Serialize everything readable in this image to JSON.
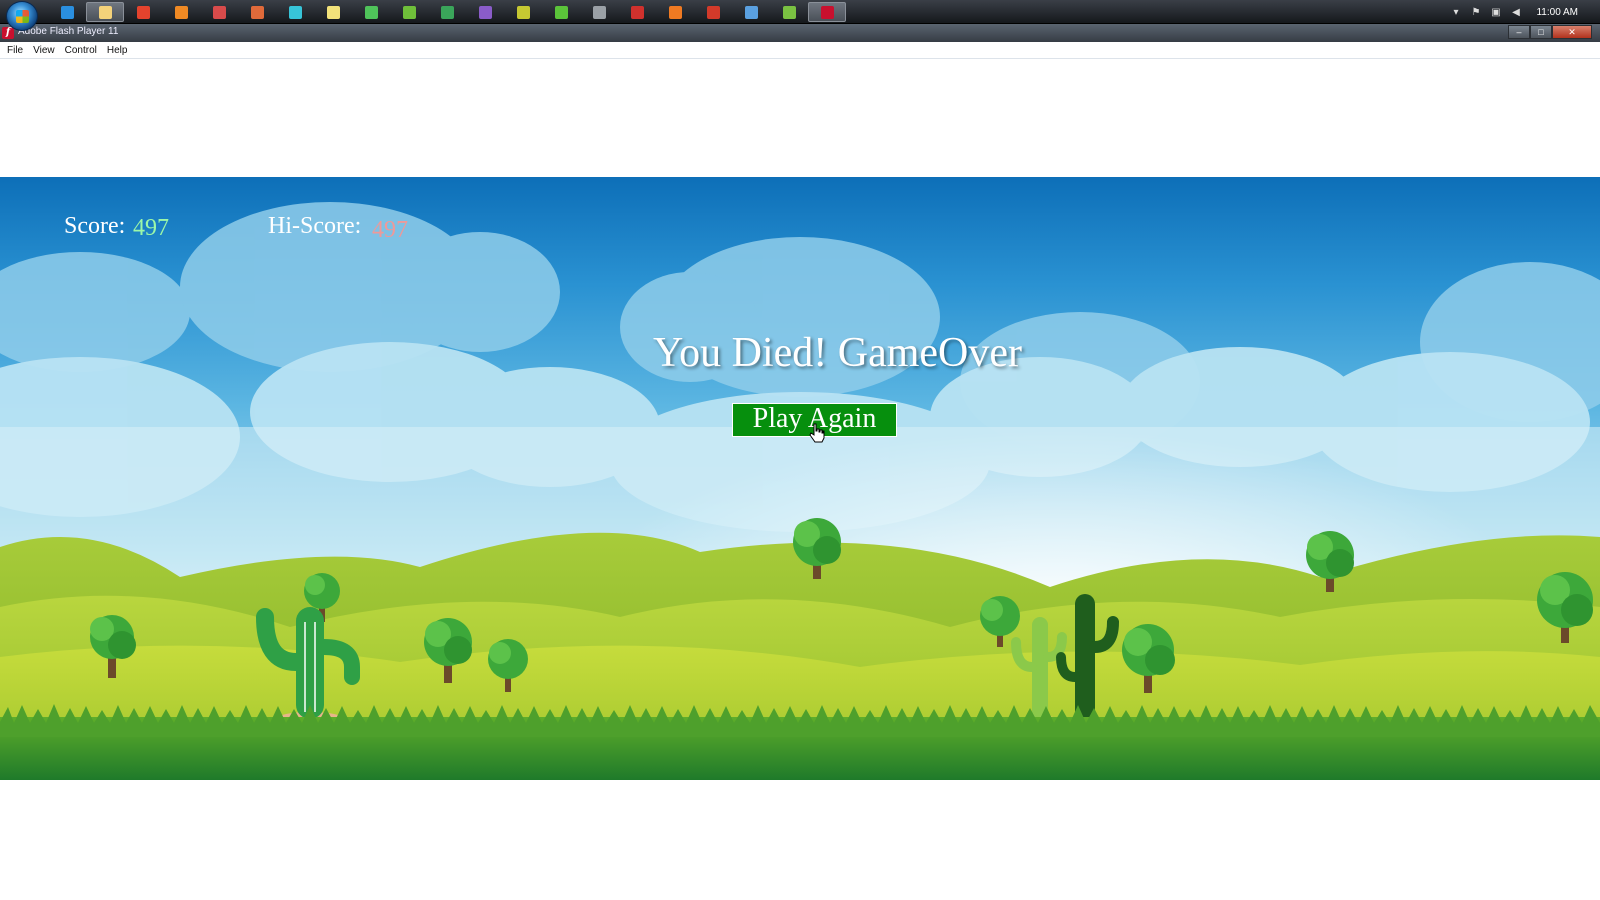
{
  "taskbar": {
    "apps": [
      {
        "name": "internet-explorer-icon",
        "color": "#2a8fe0"
      },
      {
        "name": "file-explorer-icon",
        "color": "#f4d27a",
        "active": true
      },
      {
        "name": "chrome-icon",
        "color": "#e4432d"
      },
      {
        "name": "xampp-icon",
        "color": "#f08a24"
      },
      {
        "name": "paint-icon",
        "color": "#d84b4b"
      },
      {
        "name": "media-icon",
        "color": "#e06a3a"
      },
      {
        "name": "image-editor-icon",
        "color": "#37c4d8"
      },
      {
        "name": "notepad-icon",
        "color": "#f2e27a"
      },
      {
        "name": "spreadsheet-icon",
        "color": "#4fc35a"
      },
      {
        "name": "graph-icon",
        "color": "#6fbf3a"
      },
      {
        "name": "globe-icon",
        "color": "#3aa55a"
      },
      {
        "name": "visual-studio-icon",
        "color": "#8a5cc9"
      },
      {
        "name": "fireworks-icon",
        "color": "#c6c832"
      },
      {
        "name": "dreamweaver-icon",
        "color": "#5bc43a"
      },
      {
        "name": "sound-icon",
        "color": "#9aa0a6"
      },
      {
        "name": "flash-pro-icon",
        "color": "#d0312d"
      },
      {
        "name": "firefox-icon",
        "color": "#f07a22"
      },
      {
        "name": "acrobat-icon",
        "color": "#d23a2a"
      },
      {
        "name": "keyboard-icon",
        "color": "#5aa0e0"
      },
      {
        "name": "utorrent-icon",
        "color": "#7ac142"
      },
      {
        "name": "flash-player-icon",
        "color": "#c8102e",
        "active": true
      }
    ],
    "clock": "11:00 AM"
  },
  "window": {
    "title": "Adobe Flash Player 11",
    "logo_letter": "f",
    "minimize": "–",
    "maximize": "□",
    "close": "✕"
  },
  "menu": [
    "File",
    "View",
    "Control",
    "Help"
  ],
  "game": {
    "score_label": "Score:",
    "score": "497",
    "hiscore_label": "Hi-Score:",
    "hiscore": "497",
    "gameover": "You Died! GameOver",
    "play_again": "Play Again"
  },
  "colors": {
    "score_value": "#9cf7a8",
    "hiscore_value": "#ee9999",
    "button_bg": "#068f0d"
  }
}
